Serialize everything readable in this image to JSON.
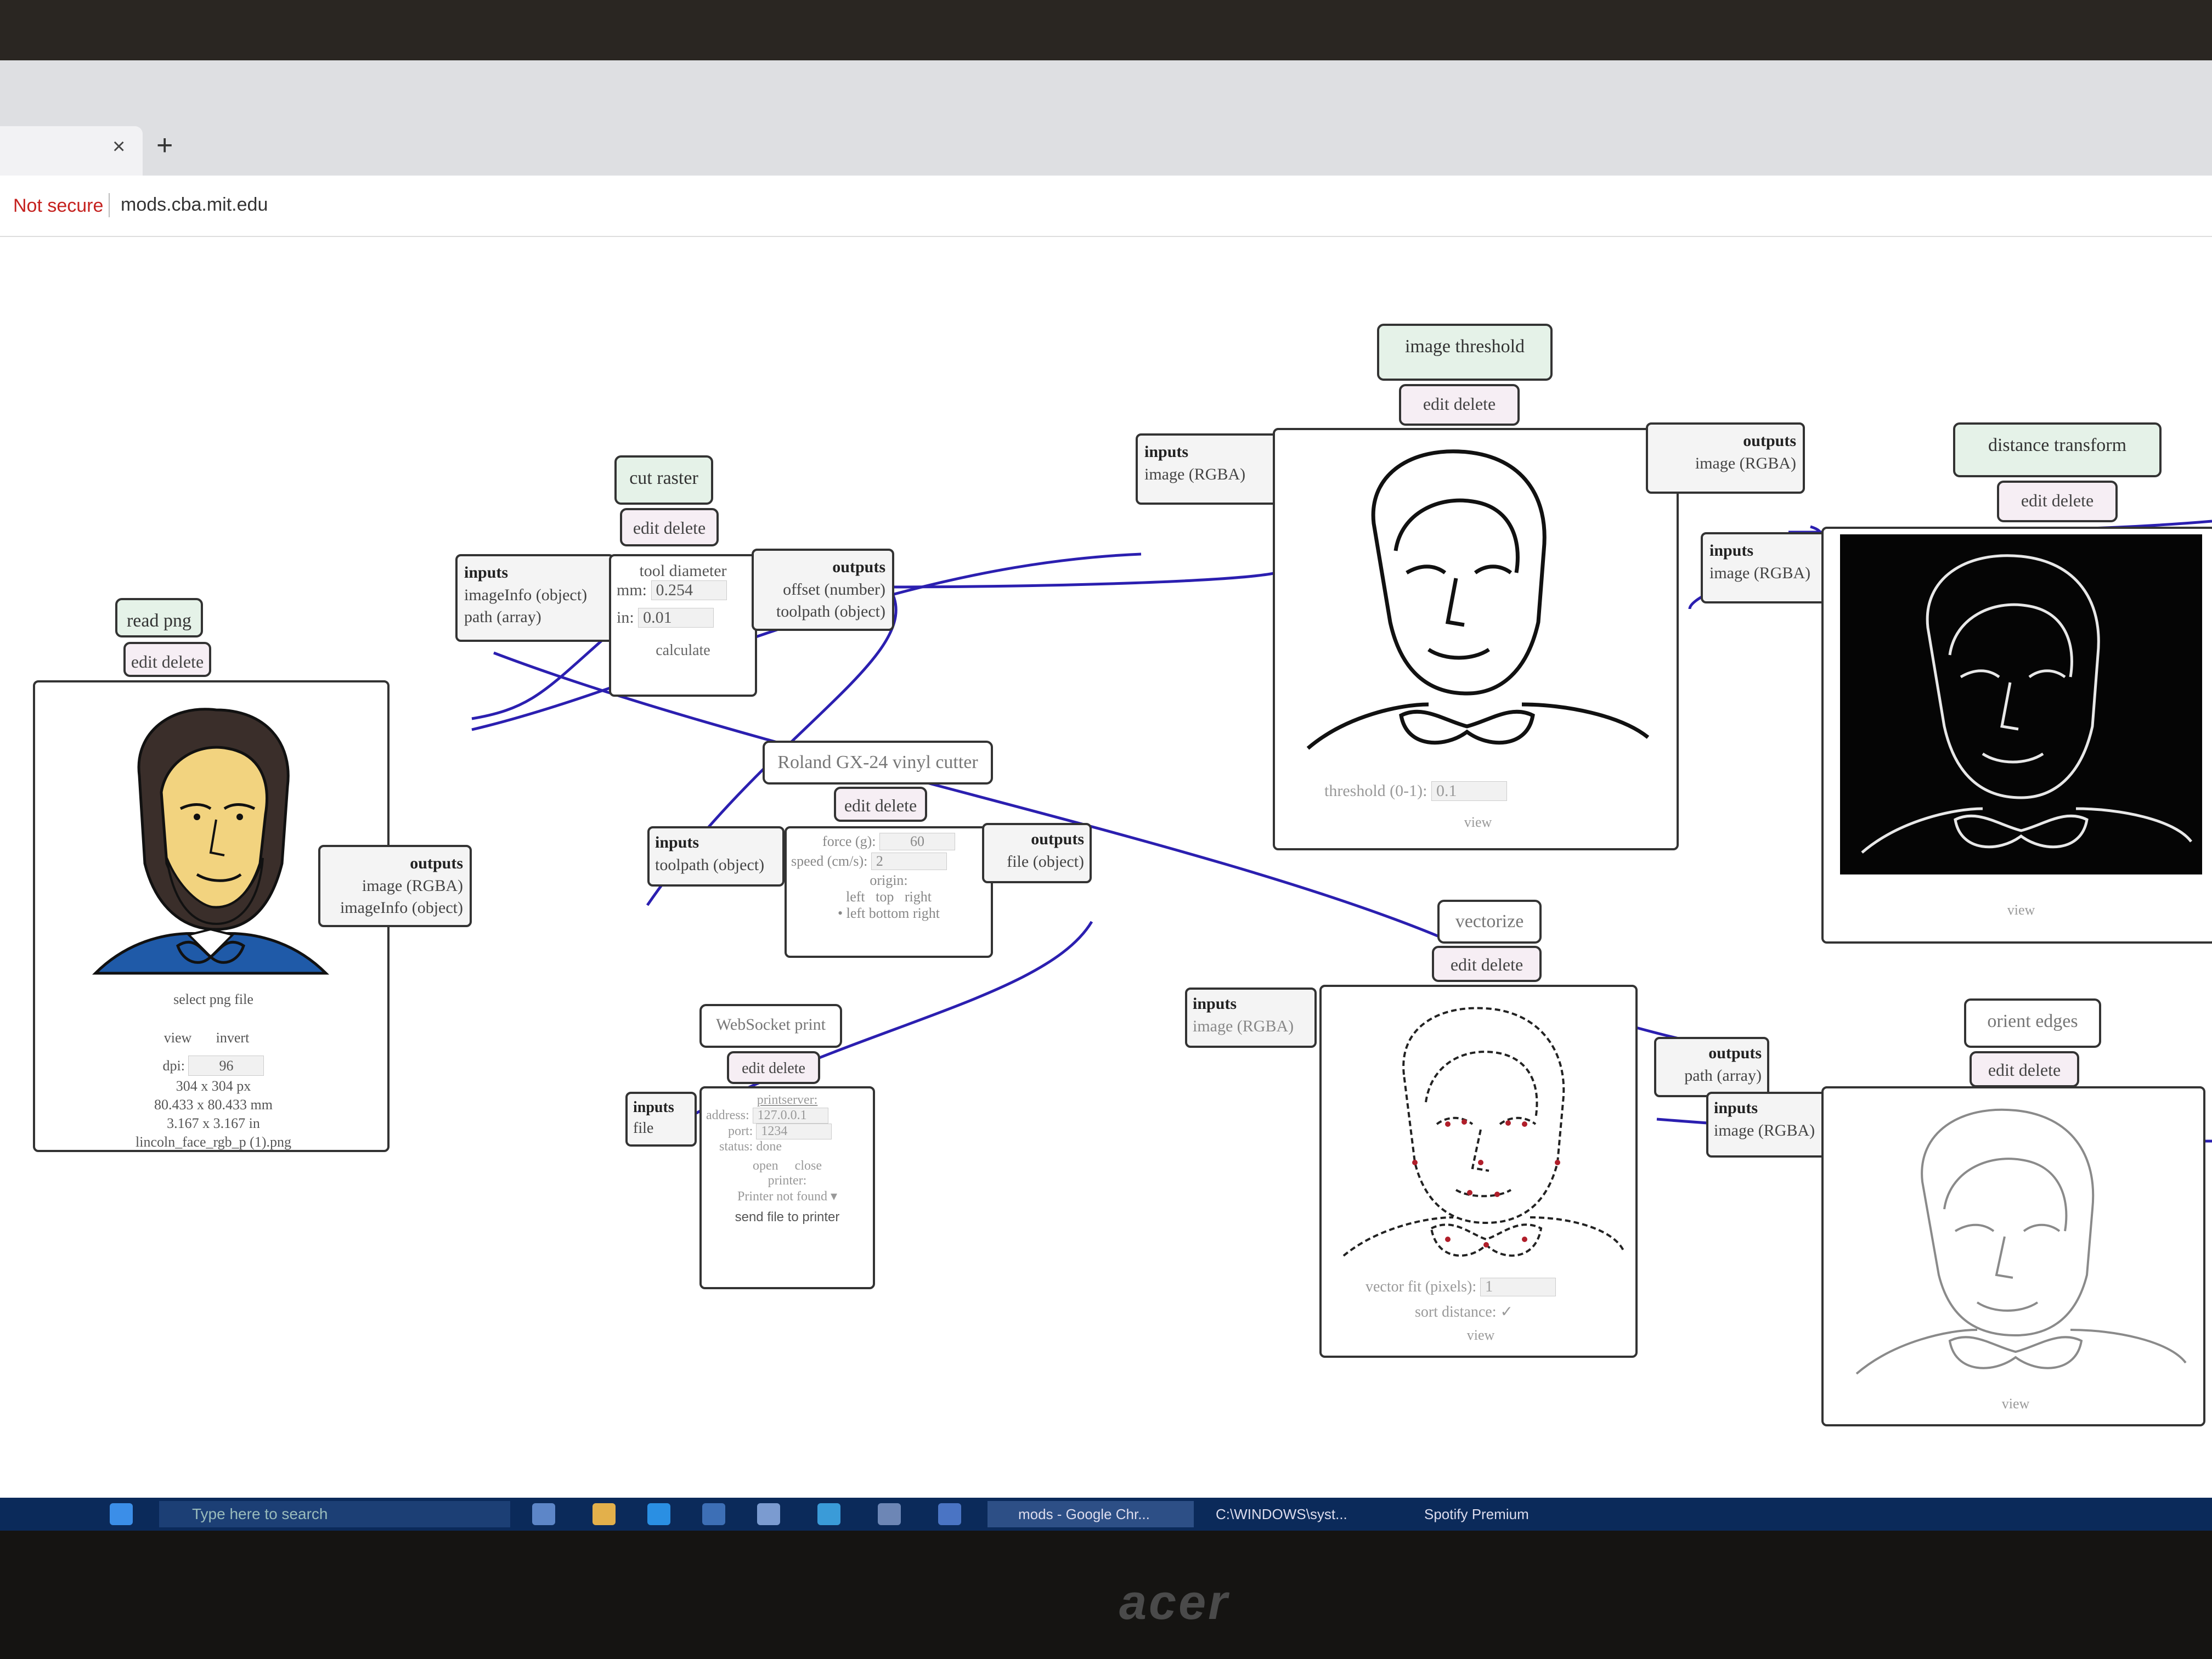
{
  "browser": {
    "new_tab": "+",
    "close_tab": "×",
    "security": "Not secure",
    "url": "mods.cba.mit.edu"
  },
  "modules": {
    "read_png": {
      "title": "read png",
      "controls": "edit delete",
      "select": "select png file",
      "view": "view",
      "invert": "invert",
      "dpi_label": "dpi:",
      "dpi_value": "96",
      "size_px": "304 x 304 px",
      "size_mm": "80.433 x 80.433 mm",
      "size_in": "3.167 x 3.167 in",
      "filename": "lincoln_face_rgb_p (1).png",
      "outputs_header": "outputs",
      "output_1": "image (RGBA)",
      "output_2": "imageInfo (object)"
    },
    "cut_raster": {
      "title": "cut raster",
      "controls": "edit delete",
      "inputs_header": "inputs",
      "input_1": "imageInfo (object)",
      "input_2": "path (array)",
      "tool_diameter": "tool diameter",
      "mm_label": "mm:",
      "mm_value": "0.254",
      "in_label": "in:",
      "in_value": "0.01",
      "calculate": "calculate",
      "outputs_header": "outputs",
      "output_1": "offset (number)",
      "output_2": "toolpath (object)"
    },
    "image_threshold": {
      "title": "image threshold",
      "controls": "edit delete",
      "inputs_header": "inputs",
      "input_1": "image (RGBA)",
      "threshold_label": "threshold (0-1):",
      "threshold_value": "0.1",
      "view": "view",
      "outputs_header": "outputs",
      "output_1": "image (RGBA)"
    },
    "distance_transform": {
      "title": "distance transform",
      "controls": "edit delete",
      "inputs_header": "inputs",
      "input_1": "image (RGBA)",
      "view": "view"
    },
    "roland": {
      "title": "Roland GX-24 vinyl cutter",
      "controls": "edit delete",
      "inputs_header": "inputs",
      "input_1": "toolpath (object)",
      "force_label": "force (g):",
      "force_value": "60",
      "speed_label": "speed (cm/s):",
      "speed_value": "2",
      "origin_label": "origin:",
      "origin_row_1": "left   top   right",
      "origin_row_2": "left bottom right",
      "outputs_header": "outputs",
      "output_1": "file (object)"
    },
    "websocket": {
      "title": "WebSocket print",
      "controls": "edit delete",
      "inputs_header": "inputs",
      "input_1": "file",
      "printserver": "printserver:",
      "address_label": "address:",
      "address_value": "127.0.0.1",
      "port_label": "port:",
      "port_value": "1234",
      "status_label": "status:",
      "status_value": "done",
      "open": "open",
      "close": "close",
      "printer_label": "printer:",
      "printer_value": "Printer not found",
      "send": "send file to printer"
    },
    "vectorize": {
      "title": "vectorize",
      "controls": "edit delete",
      "inputs_header": "inputs",
      "input_1": "image (RGBA)",
      "vector_fit_label": "vector fit (pixels):",
      "vector_fit_value": "1",
      "sort_label": "sort distance:",
      "sort_value": "✓",
      "view": "view",
      "outputs_header": "outputs",
      "output_1": "path (array)"
    },
    "orient_edges": {
      "title": "orient edges",
      "controls": "edit delete",
      "inputs_header": "inputs",
      "input_1": "image (RGBA)",
      "view": "view"
    }
  },
  "taskbar": {
    "search_placeholder": "Type here to search",
    "app_1": "mods - Google Chr...",
    "app_2": "C:\\WINDOWS\\syst...",
    "app_3": "Spotify Premium"
  },
  "monitor_brand": "acer",
  "colors": {
    "wire": "#2b1fb0",
    "title_bg": "#e5f2e8",
    "controls_bg": "#f6eef4",
    "not_secure": "#c5221f",
    "taskbar": "#0b2a5a"
  }
}
